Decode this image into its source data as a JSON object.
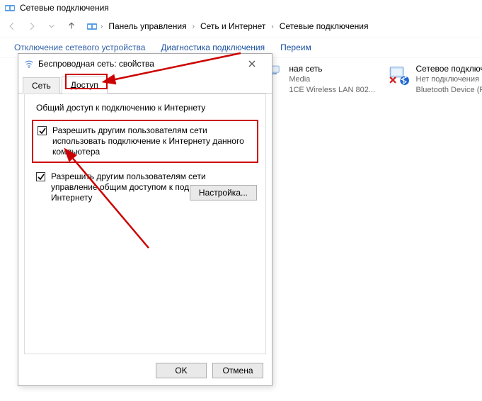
{
  "window": {
    "title": "Сетевые подключения"
  },
  "breadcrumbs": {
    "item1": "Панель управления",
    "item2": "Сеть и Интернет",
    "item3": "Сетевые подключения"
  },
  "toolbar": {
    "disable": "Отключение сетевого устройства",
    "diagnose": "Диагностика подключения",
    "rename": "Переим"
  },
  "connections": {
    "wifi": {
      "name": "ная сеть",
      "line2": "Media",
      "line3": "1CE Wireless LAN 802..."
    },
    "bt": {
      "name": "Сетевое подключен",
      "line2": "Нет подключения",
      "line3": "Bluetooth Device (P"
    }
  },
  "dialog": {
    "title": "Беспроводная сеть: свойства",
    "tabs": {
      "net": "Сеть",
      "access": "Доступ"
    },
    "group": "Общий доступ к подключению к Интернету",
    "check1": "Разрешить другим пользователям сети использовать подключение к Интернету данного компьютера",
    "check2": "Разрешить другим пользователям сети управление общим доступом к подключению к Интернету",
    "settings_btn": "Настройка...",
    "ok": "OK",
    "cancel": "Отмена"
  }
}
